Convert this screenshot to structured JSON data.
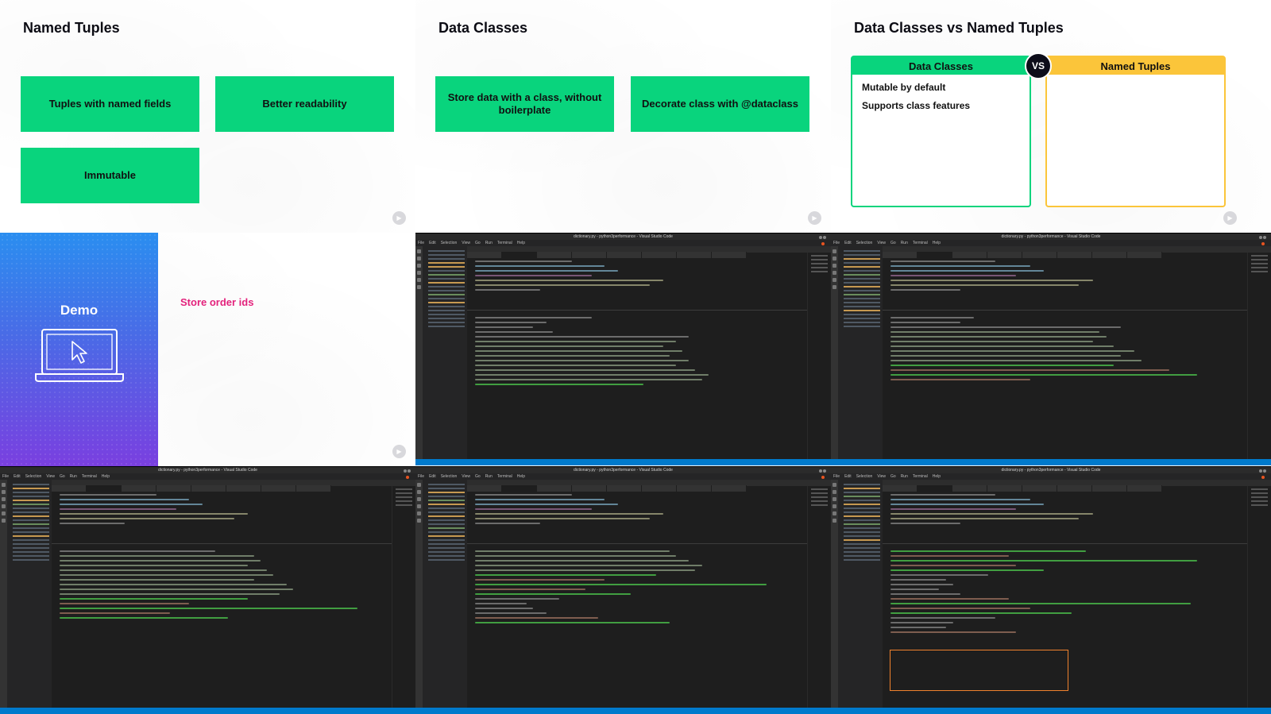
{
  "slide_named_tuples": {
    "title": "Named Tuples",
    "boxes": [
      "Tuples with named fields",
      "Better readability",
      "Immutable"
    ]
  },
  "slide_data_classes": {
    "title": "Data Classes",
    "boxes": [
      "Store data with a class, without boilerplate",
      "Decorate class with @dataclass"
    ]
  },
  "slide_comparison": {
    "title": "Data Classes vs Named Tuples",
    "vs_label": "VS",
    "data_classes_header": "Data Classes",
    "data_classes_items": [
      "Mutable by default",
      "Supports class features"
    ],
    "named_tuples_header": "Named Tuples",
    "colors": {
      "green": "#09d47d",
      "yellow": "#fbc53a",
      "dark": "#0d0d1a"
    }
  },
  "slide_demo": {
    "title": "Demo",
    "note": "Store order ids",
    "icon": "laptop-cursor-icon",
    "note_color": "#e3227c"
  },
  "vscode": {
    "window_title": "dictionary.py - python3performance - Visual Studio Code",
    "menu": [
      "File",
      "Edit",
      "Selection",
      "View",
      "Go",
      "Run",
      "Terminal",
      "Help"
    ]
  }
}
